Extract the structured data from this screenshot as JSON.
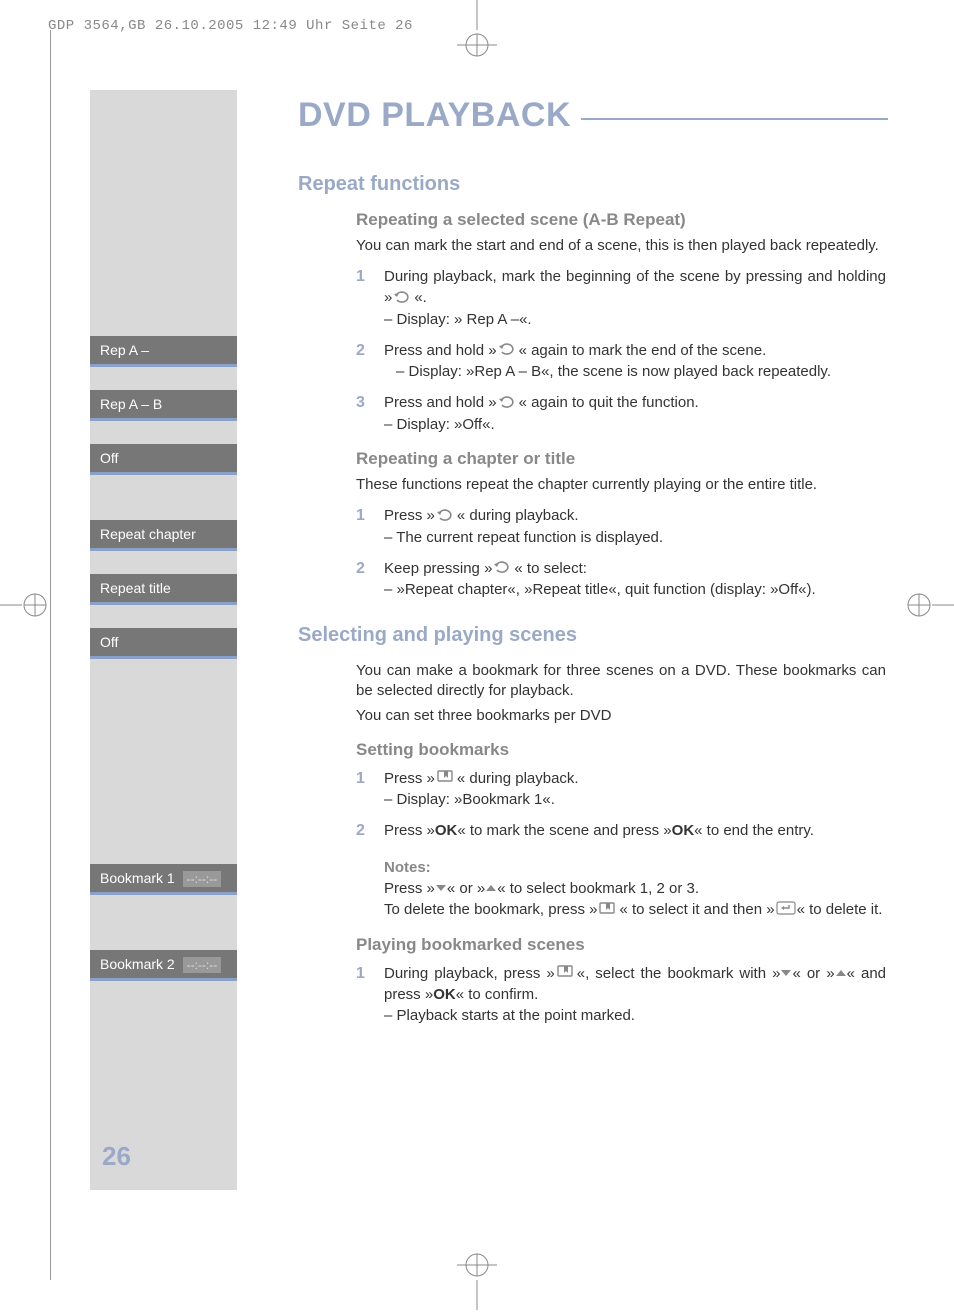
{
  "header": "GDP 3564,GB  26.10.2005  12:49 Uhr  Seite 26",
  "page_number": "26",
  "title": "DVD PLAYBACK",
  "sidebar": {
    "items": [
      "Rep A –",
      "Rep A – B",
      "Off",
      "Repeat chapter",
      "Repeat title",
      "Off"
    ],
    "bookmarks": [
      {
        "label": "Bookmark 1",
        "time": "--:--:--"
      },
      {
        "label": "Bookmark 2",
        "time": "--:--:--"
      }
    ]
  },
  "sections": {
    "repeat": {
      "heading": "Repeat functions",
      "ab": {
        "heading": "Repeating a selected scene (A-B Repeat)",
        "intro": "You can mark the start and end of a scene, this is then played back repeatedly.",
        "steps": [
          {
            "n": "1",
            "t": "During playback, mark the beginning of the scene by pressing and holding »",
            "after": "«.",
            "sub": "– Display: » Rep A –«."
          },
          {
            "n": "2",
            "t": "Press and hold »",
            "after": "« again to mark the end of the scene.",
            "sub": "– Display: »Rep A – B«, the scene is now played back repeatedly."
          },
          {
            "n": "3",
            "t": "Press and hold »",
            "after": "« again to quit the function.",
            "sub": "– Display: »Off«."
          }
        ]
      },
      "ct": {
        "heading": "Repeating a chapter or title",
        "intro": "These functions repeat the chapter currently playing or the entire title.",
        "steps": [
          {
            "n": "1",
            "t": "Press »",
            "after": "« during playback.",
            "sub": "– The current repeat function is displayed."
          },
          {
            "n": "2",
            "t": "Keep pressing »",
            "after": "« to select:",
            "sub": "– »Repeat chapter«, »Repeat title«, quit function (display: »Off«)."
          }
        ]
      }
    },
    "scenes": {
      "heading": "Selecting and playing scenes",
      "intro1": "You can make a bookmark for three scenes on a DVD. These bookmarks can be selected directly for playback.",
      "intro2": "You can set three bookmarks per DVD",
      "set": {
        "heading": "Setting bookmarks",
        "steps": [
          {
            "n": "1",
            "t": "Press »",
            "after": "« during playback.",
            "sub": "– Display: »Bookmark 1«."
          },
          {
            "n": "2",
            "t": "Press »",
            "ok1": "OK",
            "mid": "« to mark the scene and press »",
            "ok2": "OK",
            "after": "« to end the entry."
          }
        ],
        "notes_label": "Notes:",
        "notes1a": "Press »",
        "notes1b": "« or »",
        "notes1c": "« to select bookmark 1, 2 or 3.",
        "notes2a": "To delete the bookmark, press »",
        "notes2b": "« to select it and then »",
        "notes2c": "« to delete it."
      },
      "play": {
        "heading": "Playing bookmarked scenes",
        "step": {
          "n": "1",
          "t1": "During playback, press »",
          "t2": "«, select the bookmark with »",
          "t3": "« or »",
          "t4": "« and press »",
          "ok": "OK",
          "t5": "« to confirm.",
          "sub": "– Playback starts at the point marked."
        }
      }
    }
  }
}
